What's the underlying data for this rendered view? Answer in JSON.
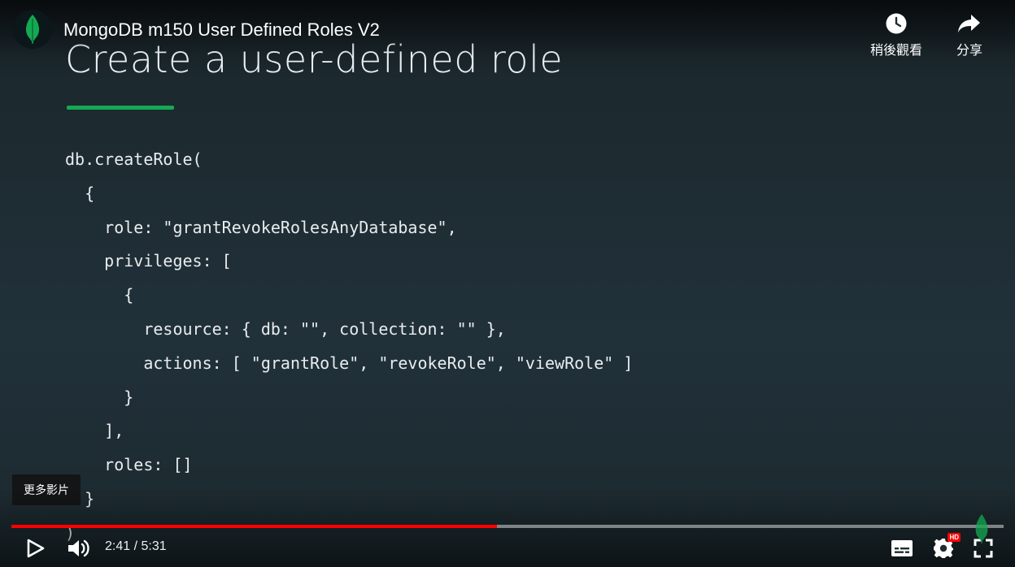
{
  "video": {
    "title": "MongoDB m150 User Defined Roles V2"
  },
  "slide": {
    "title": "Create a user-defined role",
    "accent_color": "#13aa52",
    "code_lines": [
      "db.createRole(",
      "  {",
      "    role: \"grantRevokeRolesAnyDatabase\",",
      "    privileges: [",
      "      {",
      "        resource: { db: \"\", collection: \"\" },",
      "        actions: [ \"grantRole\", \"revokeRole\", \"viewRole\" ]",
      "      }",
      "    ],",
      "    roles: []",
      "  }",
      ")"
    ]
  },
  "top_actions": {
    "watch_later": {
      "label": "稍後觀看",
      "icon": "clock-icon"
    },
    "share": {
      "label": "分享",
      "icon": "share-arrow-icon"
    }
  },
  "tooltip": {
    "more_videos": "更多影片"
  },
  "player": {
    "current_time": "2:41",
    "separator": " / ",
    "duration": "5:31",
    "progress_fraction": 0.489,
    "progress_color": "#ff0000",
    "settings_badge": "HD",
    "icons": [
      "play-icon",
      "volume-icon",
      "subtitles-icon",
      "settings-gear-icon",
      "fullscreen-icon"
    ]
  }
}
